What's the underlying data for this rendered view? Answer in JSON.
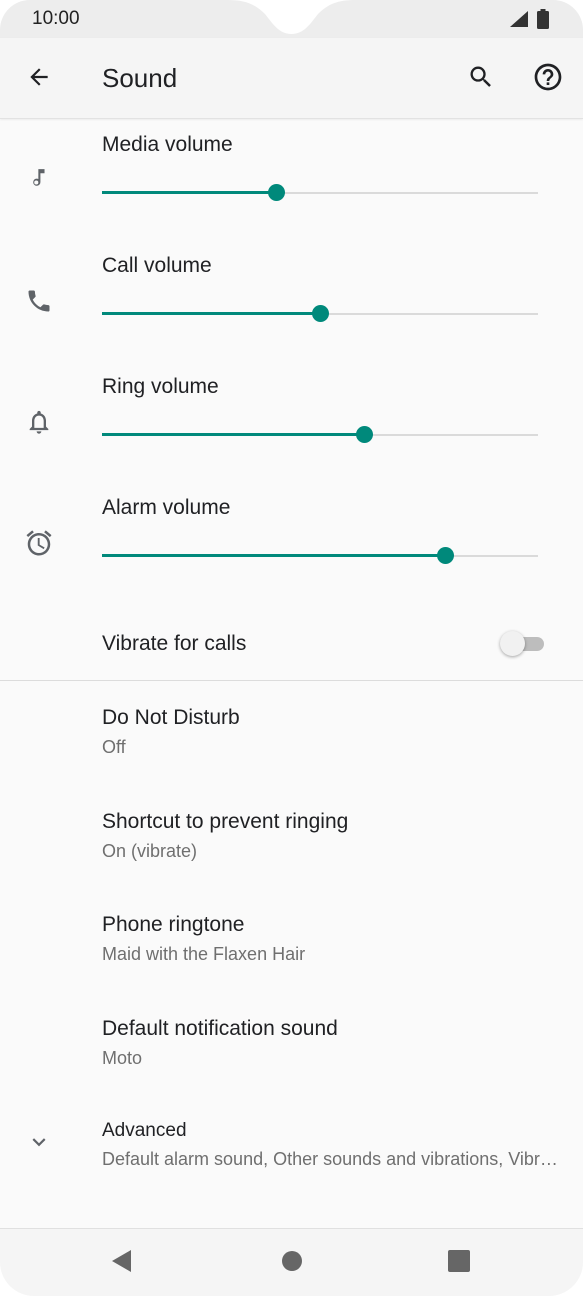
{
  "status_bar": {
    "time": "10:00",
    "icons": [
      "signal-icon",
      "battery-icon"
    ]
  },
  "app_bar": {
    "title": "Sound",
    "icons": [
      "back-arrow-icon",
      "search-icon",
      "help-icon"
    ]
  },
  "volumes": [
    {
      "label": "Media volume",
      "icon": "music-note-icon",
      "level": 0.4
    },
    {
      "label": "Call volume",
      "icon": "phone-icon",
      "level": 0.5
    },
    {
      "label": "Ring volume",
      "icon": "bell-icon",
      "level": 0.6
    },
    {
      "label": "Alarm volume",
      "icon": "alarm-clock-icon",
      "level": 0.786
    }
  ],
  "vibrate": {
    "label": "Vibrate for calls",
    "enabled": false
  },
  "preferences": [
    {
      "title": "Do Not Disturb",
      "summary": "Off"
    },
    {
      "title": "Shortcut to prevent ringing",
      "summary": "On (vibrate)"
    },
    {
      "title": "Phone ringtone",
      "summary": "Maid with the Flaxen Hair"
    },
    {
      "title": "Default notification sound",
      "summary": "Moto"
    }
  ],
  "advanced": {
    "title": "Advanced",
    "summary": "Default alarm sound, Other sounds and vibrations, Vibration",
    "icon": "chevron-down-icon"
  },
  "nav_bar": {
    "icons": [
      "back-triangle-icon",
      "home-circle-icon",
      "recents-square-icon"
    ]
  },
  "colors": {
    "accent": "#00897b",
    "track": "#dadada",
    "background": "#fafafa"
  }
}
